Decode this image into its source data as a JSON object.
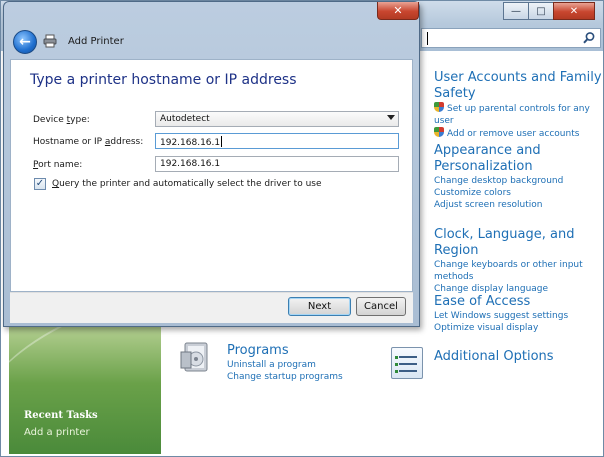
{
  "control_panel": {
    "search_placeholder": "",
    "left_pane": {
      "recent_tasks_title": "Recent Tasks",
      "recent_tasks": [
        "Add a printer"
      ]
    },
    "categories": {
      "user_accounts": {
        "title_line1": "User Accounts and Family",
        "title_line2": "Safety",
        "links": [
          "Set up parental controls for any user",
          "Add or remove user accounts"
        ]
      },
      "appearance": {
        "title_line1": "Appearance and",
        "title_line2": "Personalization",
        "links": [
          "Change desktop background",
          "Customize colors",
          "Adjust screen resolution"
        ]
      },
      "clock": {
        "title": "Clock, Language, and Region",
        "links": [
          "Change keyboards or other input",
          "methods",
          "Change display language"
        ]
      },
      "ease_of_access": {
        "title": "Ease of Access",
        "links": [
          "Let Windows suggest settings",
          "Optimize visual display"
        ]
      },
      "programs": {
        "title": "Programs",
        "links": [
          "Uninstall a program",
          "Change startup programs"
        ]
      },
      "additional_options": {
        "title": "Additional Options"
      }
    }
  },
  "dialog": {
    "title": "Add Printer",
    "heading": "Type a printer hostname or IP address",
    "device_type": {
      "label_pre": "Device ",
      "label_u": "t",
      "label_post": "ype:",
      "value": "Autodetect"
    },
    "hostname": {
      "label_pre": "Hostname or IP ",
      "label_u": "a",
      "label_post": "ddress:",
      "value": "192.168.16.1"
    },
    "port": {
      "label_u": "P",
      "label_post": "ort name:",
      "value": "192.168.16.1"
    },
    "query_checkbox": {
      "checked": true,
      "label_u": "Q",
      "label_post": "uery the printer and automatically select the driver to use"
    },
    "next_label": "Next",
    "cancel_label": "Cancel"
  },
  "colors": {
    "link": "#1e6fb5",
    "heading": "#1e3287",
    "close_red": "#c8462f",
    "green_pane": "#6aa149"
  }
}
